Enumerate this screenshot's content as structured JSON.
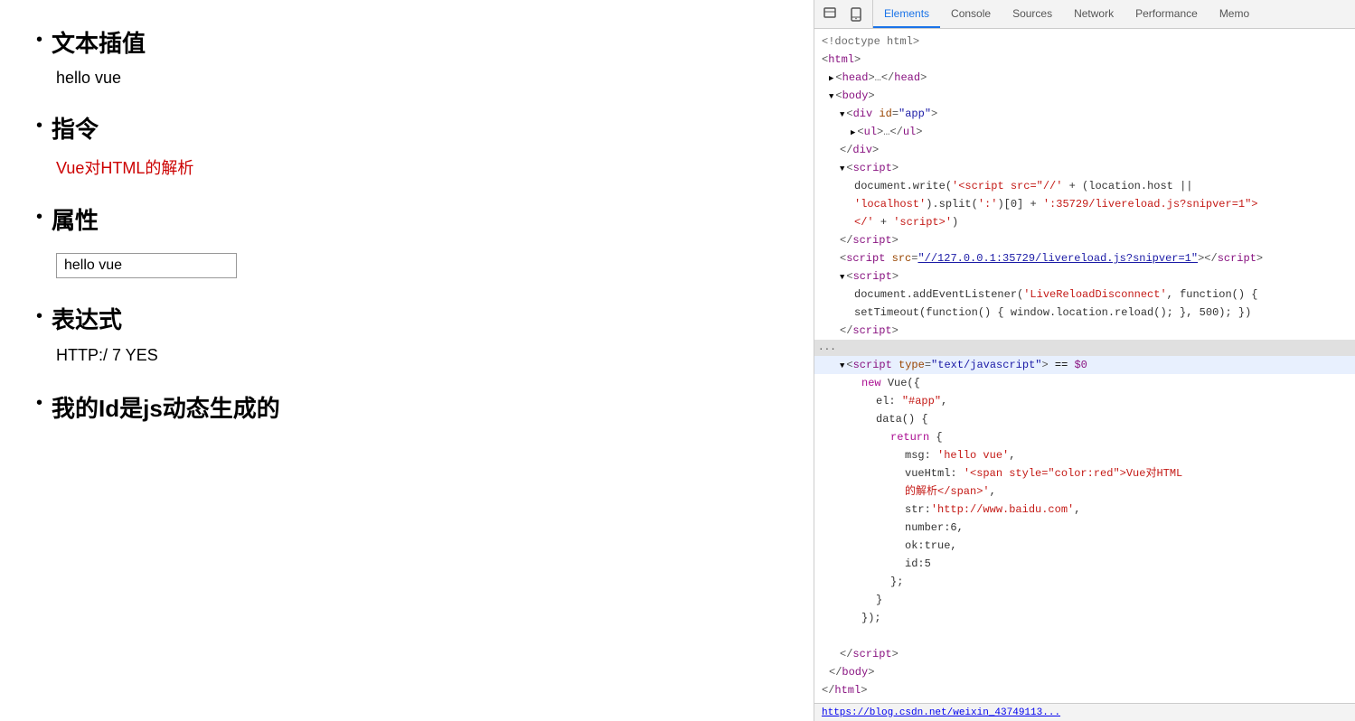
{
  "left": {
    "sections": [
      {
        "id": "text-interpolation",
        "title": "文本插值",
        "content": "hello vue",
        "type": "text"
      },
      {
        "id": "directive",
        "title": "指令",
        "content": "Vue对HTML的解析",
        "type": "red"
      },
      {
        "id": "attribute",
        "title": "属性",
        "inputValue": "hello vue",
        "type": "input"
      },
      {
        "id": "expression",
        "title": "表达式",
        "content": "HTTP:/ 7 YES",
        "type": "text"
      },
      {
        "id": "dynamic-id",
        "title": "我的Id是js动态生成的",
        "type": "noContent"
      }
    ]
  },
  "devtools": {
    "tabs": [
      {
        "id": "elements",
        "label": "Elements",
        "active": true
      },
      {
        "id": "console",
        "label": "Console",
        "active": false
      },
      {
        "id": "sources",
        "label": "Sources",
        "active": false
      },
      {
        "id": "network",
        "label": "Network",
        "active": false
      },
      {
        "id": "performance",
        "label": "Performance",
        "active": false
      },
      {
        "id": "memo",
        "label": "Memo",
        "active": false
      }
    ],
    "statusbar": "https://blog.csdn.net/weixin_43749113..."
  }
}
